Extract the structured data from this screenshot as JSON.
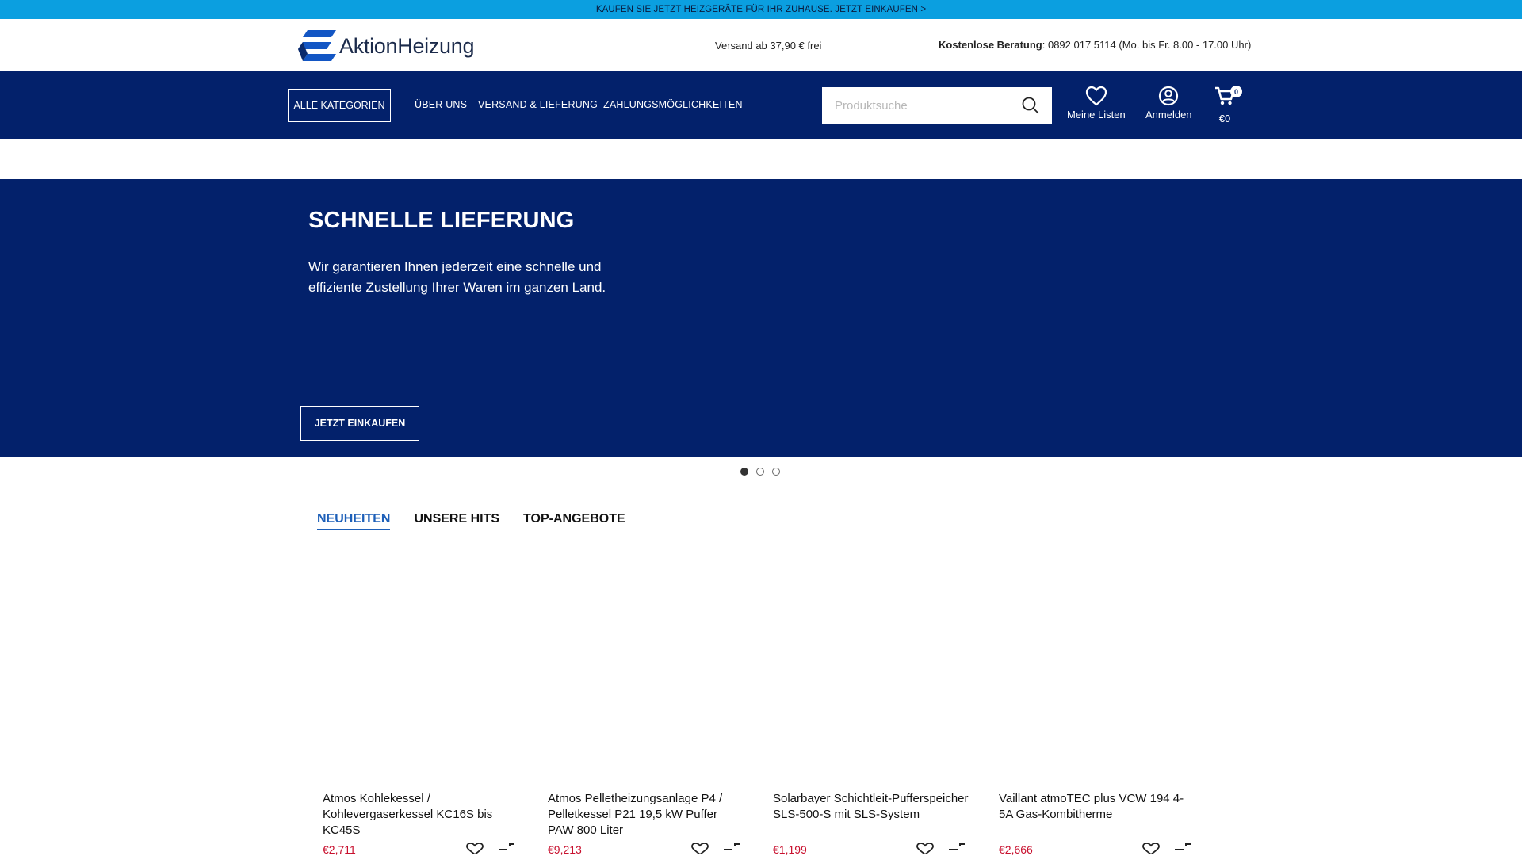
{
  "promo": {
    "text": "KAUFEN SIE JETZT HEIZGERÄTE FÜR IHR ZUHAUSE. JETZT EINKAUFEN >"
  },
  "header": {
    "logo_text": "AktionHeizung",
    "shipping": "Versand ab 37,90 € frei",
    "consult_bold": "Kostenlose Beratung",
    "consult_rest": ": 0892 017 5114 (Mo. bis Fr. 8.00 - 17.00 Uhr)"
  },
  "nav": {
    "categories_label": "ALLE KATEGORIEN",
    "links": [
      "ÜBER UNS",
      "VERSAND & LIEFERUNG",
      "ZAHLUNGSMÖGLICHKEITEN"
    ],
    "search_placeholder": "Produktsuche",
    "lists_label": "Meine Listen",
    "login_label": "Anmelden",
    "cart_label": "€0",
    "cart_count": "0"
  },
  "hero": {
    "title": "SCHNELLE LIEFERUNG",
    "text": "Wir garantieren Ihnen jederzeit eine schnelle und effiziente Zustellung Ihrer Waren im ganzen Land.",
    "button": "JETZT EINKAUFEN",
    "slides": 3,
    "active_slide": 1
  },
  "tabs": [
    {
      "label": "NEUHEITEN",
      "active": true
    },
    {
      "label": "UNSERE HITS",
      "active": false
    },
    {
      "label": "TOP-ANGEBOTE",
      "active": false
    }
  ],
  "products": [
    {
      "name": "Atmos Kohlekessel / Kohlevergaserkessel KC16S bis KC45S",
      "old_price": "€2,711"
    },
    {
      "name": "Atmos Pelletheizungsanlage P4 / Pelletkessel P21 19,5 kW Puffer PAW 800 Liter",
      "old_price": "€9,213"
    },
    {
      "name": "Solarbayer Schichtleit-Pufferspeicher SLS-500-S mit SLS-System",
      "old_price": "€1,199"
    },
    {
      "name": "Vaillant atmoTEC plus VCW 194 4-5A Gas-Kombitherme",
      "old_price": "€2,666"
    }
  ],
  "colors": {
    "navy": "#03216b",
    "promo": "#0b9fe0",
    "accent": "#1d5fb8",
    "sale": "#c8102e"
  }
}
